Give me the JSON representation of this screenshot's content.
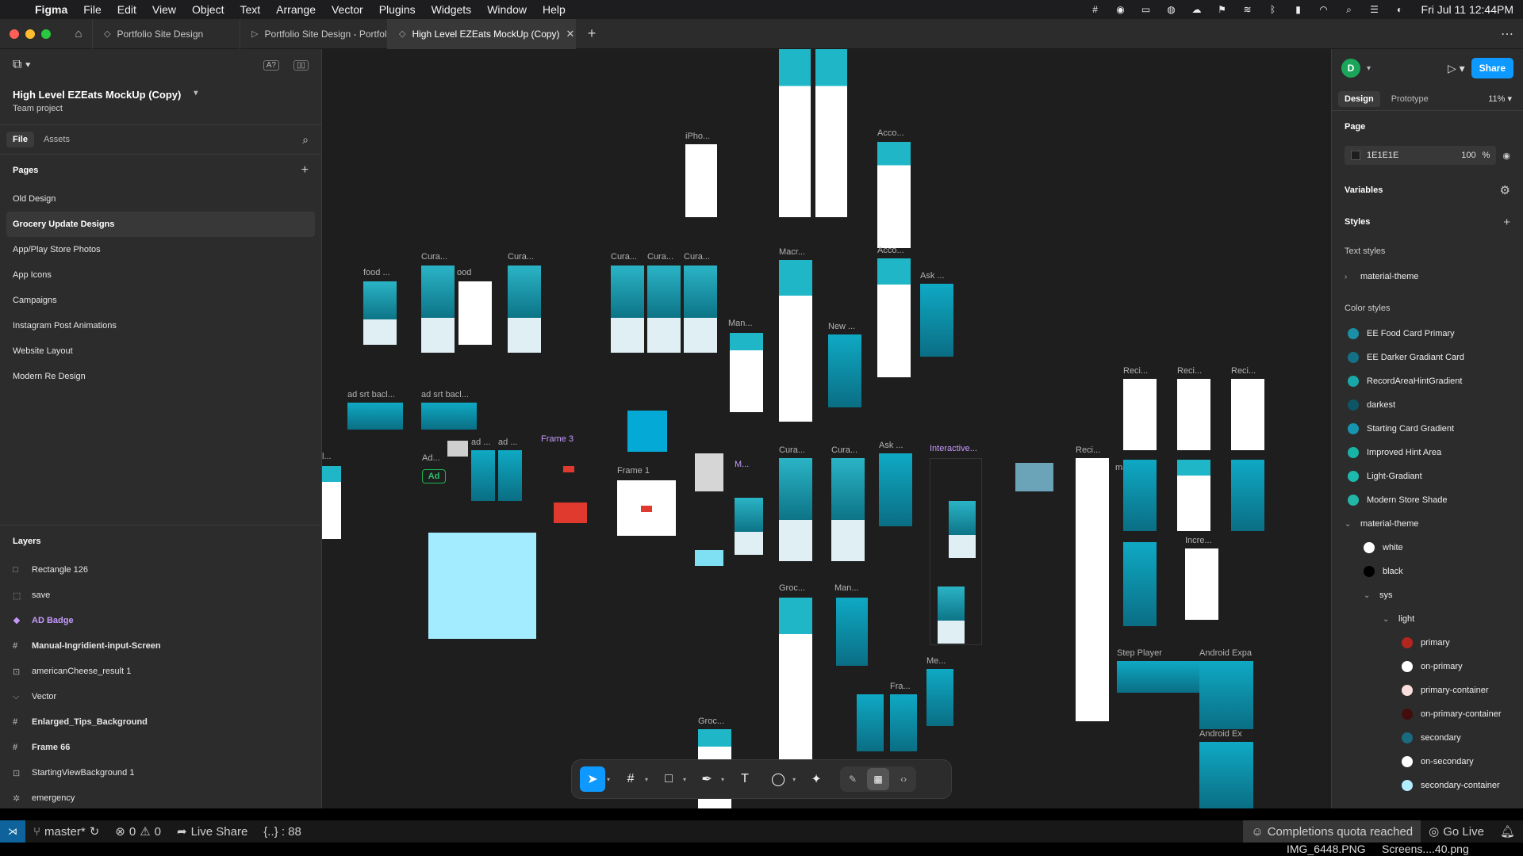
{
  "menubar": {
    "app": "Figma",
    "items": [
      "File",
      "Edit",
      "View",
      "Object",
      "Text",
      "Arrange",
      "Vector",
      "Plugins",
      "Widgets",
      "Window",
      "Help"
    ],
    "clock": "Fri Jul 11  12:44PM"
  },
  "tabs": {
    "items": [
      {
        "label": "Portfolio Site Design",
        "icon": "file-icon"
      },
      {
        "label": "Portfolio Site Design - Portfolio Pages",
        "icon": "prototype-icon"
      },
      {
        "label": "High Level EZEats MockUp (Copy)",
        "icon": "file-icon"
      }
    ]
  },
  "left": {
    "project_title": "High Level EZEats MockUp (Copy)",
    "project_sub": "Team project",
    "tab_file": "File",
    "tab_assets": "Assets",
    "pages_title": "Pages",
    "pages": [
      "Old Design",
      "Grocery Update Designs",
      "App/Play Store Photos",
      "App Icons",
      "Campaigns",
      "Instagram Post Animations",
      "Website Layout",
      "Modern Re Design"
    ],
    "layers_title": "Layers",
    "layers": [
      {
        "name": "Rectangle 126",
        "icon": "□"
      },
      {
        "name": "save",
        "icon": "⬚"
      },
      {
        "name": "AD Badge",
        "icon": "❖"
      },
      {
        "name": "Manual-Ingridient-input-Screen",
        "icon": "#"
      },
      {
        "name": "americanCheese_result 1",
        "icon": "⊡"
      },
      {
        "name": "Vector",
        "icon": "⌵"
      },
      {
        "name": "Enlarged_Tips_Background",
        "icon": "#"
      },
      {
        "name": "Frame 66",
        "icon": "#"
      },
      {
        "name": "StartingViewBackground 1",
        "icon": "⊡"
      },
      {
        "name": "emergency",
        "icon": "✲"
      }
    ]
  },
  "right": {
    "avatar": "D",
    "share": "Share",
    "tab_design": "Design",
    "tab_prototype": "Prototype",
    "zoom": "11%",
    "page_title": "Page",
    "page_color": "1E1E1E",
    "page_opacity": "100",
    "page_pct": "%",
    "variables": "Variables",
    "styles": "Styles",
    "text_styles": "Text styles",
    "text_style_item": "material-theme",
    "color_styles": "Color styles",
    "colors": [
      {
        "name": "EE Food Card Primary",
        "color": "#1b8fa6"
      },
      {
        "name": "EE Darker Gradiant Card",
        "color": "#137086"
      },
      {
        "name": "RecordAreaHintGradient",
        "color": "#1aa7a9"
      },
      {
        "name": "darkest",
        "color": "#0e5566"
      },
      {
        "name": "Starting Card Gradient",
        "color": "#1795b0"
      },
      {
        "name": "Improved Hint Area",
        "color": "#19b3a6"
      },
      {
        "name": "Light-Gradiant",
        "color": "#1cb9ac"
      },
      {
        "name": "Modern Store Shade",
        "color": "#22b5a8"
      }
    ],
    "group_name": "material-theme",
    "tree": [
      {
        "name": "white",
        "color": "#ffffff",
        "indent": 1
      },
      {
        "name": "black",
        "color": "#000000",
        "indent": 1
      },
      {
        "name": "sys",
        "indent": 1,
        "folder": true
      },
      {
        "name": "light",
        "indent": 2,
        "folder": true
      },
      {
        "name": "primary",
        "color": "#b3261e",
        "indent": 3
      },
      {
        "name": "on-primary",
        "color": "#ffffff",
        "indent": 3
      },
      {
        "name": "primary-container",
        "color": "#f9dedc",
        "indent": 3
      },
      {
        "name": "on-primary-container",
        "color": "#410e0b",
        "indent": 3
      },
      {
        "name": "secondary",
        "color": "#1a6a80",
        "indent": 3
      },
      {
        "name": "on-secondary",
        "color": "#ffffff",
        "indent": 3
      },
      {
        "name": "secondary-container",
        "color": "#b2ecff",
        "indent": 3
      }
    ]
  },
  "canvas": {
    "labels": [
      "iPho...",
      "Acco...",
      "Acco...",
      "food ...",
      "Cura...",
      "ood",
      "Cura...",
      "Cura...",
      "Cura...",
      "Cura...",
      "Macr...",
      "Man...",
      "New ...",
      "Ask ...",
      "ad srt bacl...",
      "ad srt bacl...",
      "Ad...",
      "ad ...",
      "ad ...",
      "Frame 3",
      "Frame 1",
      "M...",
      "Cura...",
      "Cura...",
      "Ask ...",
      "Interactive...",
      "Groc...",
      "Man...",
      "Fra...",
      "Me...",
      "Groc...",
      "Reci...",
      "Reci...",
      "Reci...",
      "Reci...",
      "ma...",
      "Incre...",
      "Step Player",
      "Android Expa",
      "Android Ex",
      "l..."
    ],
    "ad_badge": "Ad"
  },
  "statusbar": {
    "branch": "master*",
    "errors": "0",
    "warnings": "0",
    "live_share": "Live Share",
    "braces": "{..} : 88",
    "quota": "Completions quota reached",
    "go_live": "Go Live"
  },
  "files": [
    "IMG_6448.PNG",
    "Screens....40.png"
  ]
}
